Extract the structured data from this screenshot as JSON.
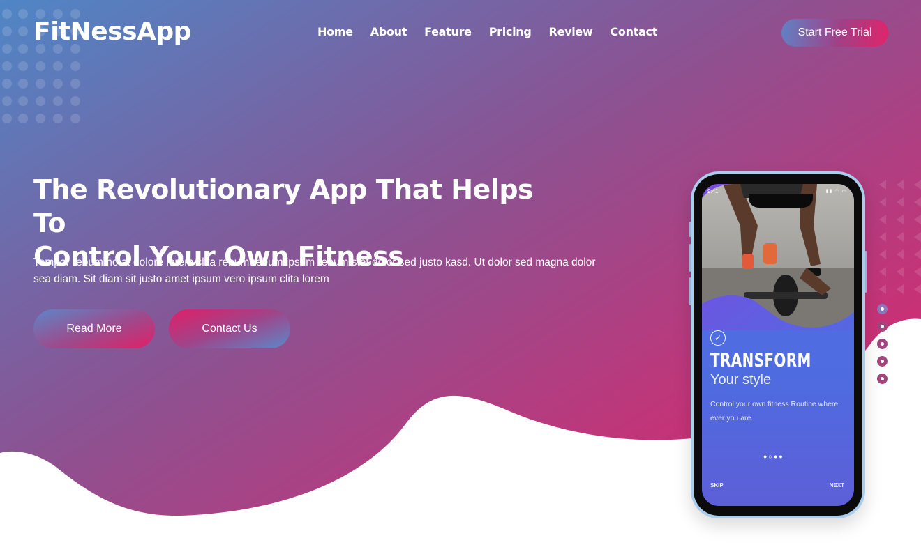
{
  "header": {
    "logo": "FitNessApp",
    "nav": [
      "Home",
      "About",
      "Feature",
      "Pricing",
      "Review",
      "Contact"
    ],
    "cta": "Start Free Trial"
  },
  "hero": {
    "title_line1": "The Revolutionary App That Helps To",
    "title_line2": "Control Your Own Fitness",
    "subtitle": "Tempor rebum no at dolore lorem clita rebum rebum ipsum rebum stet dolor sed justo kasd. Ut dolor sed magna dolor sea diam. Sit diam sit justo amet ipsum vero ipsum clita lorem",
    "read_more": "Read More",
    "contact_us": "Contact Us"
  },
  "phone": {
    "time": "9:41",
    "screen_title": "TRANSFORM",
    "screen_subtitle": "Your style",
    "screen_desc": "Control your own fitness Routine where ever you are.",
    "skip": "SKIP",
    "next": "NEXT",
    "page_dots": "●○●●"
  },
  "pager": {
    "count": 5,
    "active_index": 0
  },
  "colors": {
    "blue": "#4f86c6",
    "purple": "#8f4e8f",
    "pink": "#e0246a"
  }
}
